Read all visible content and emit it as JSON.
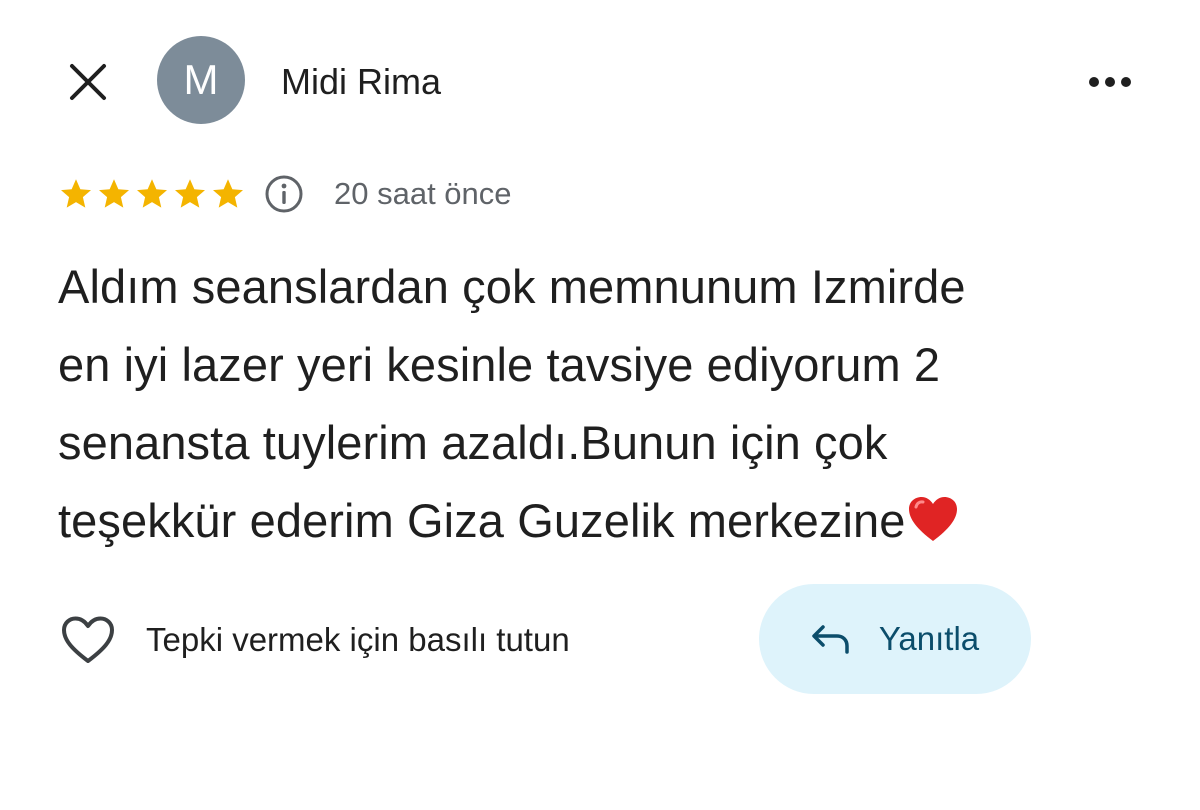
{
  "header": {
    "avatar_letter": "M",
    "author_name": "Midi Rima",
    "close_icon": "close-icon",
    "more_icon": "more-horizontal-icon"
  },
  "review": {
    "rating": 5,
    "rating_max": 5,
    "time": "20 saat önce",
    "text_lines": [
      "Aldım seanslardan çok memnunum Izmirde",
      "en iyi lazer yeri kesinle tavsiye ediyorum 2",
      "senansta tuylerim azaldı.Bunun için çok",
      "teşekkür ederim Giza Guzelik merkezine"
    ],
    "emoji": "red-heart-emoji"
  },
  "actions": {
    "react_label": "Tepki vermek için basılı tutun",
    "reply_label": "Yanıtla"
  },
  "colors": {
    "avatar_bg": "#7d8c99",
    "star": "#f4b400",
    "reply_bg": "#def3fb",
    "reply_text": "#0b4d6b",
    "secondary_text": "#5f6368"
  }
}
